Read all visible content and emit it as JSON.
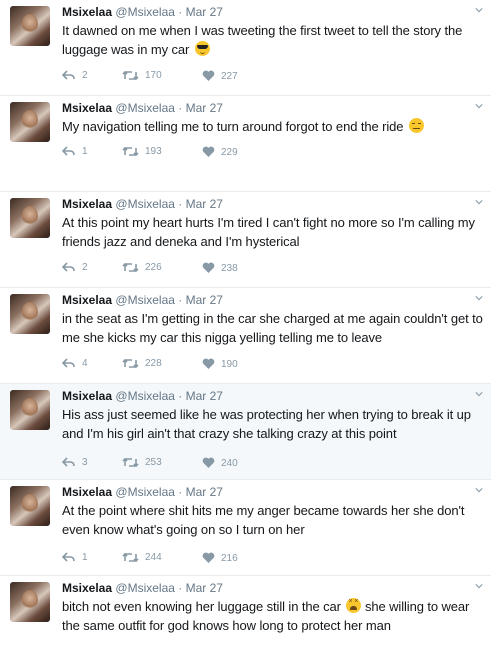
{
  "colors": {
    "name": "#14171a",
    "meta": "#657786",
    "icon": "#8899a6",
    "border": "#e6ecf0",
    "highlight_bg": "#f5f8fa"
  },
  "icons": {
    "reply": "reply-icon",
    "retweet": "retweet-icon",
    "like": "heart-icon",
    "menu": "chevron-down-icon"
  },
  "tweets": [
    {
      "name": "Msixelaa",
      "handle": "@Msixelaa",
      "separator": "·",
      "date": "Mar 27",
      "text": "It dawned on me when I was tweeting the first tweet to tell the story the luggage was in my car",
      "emoji": "sunglasses",
      "replies": "2",
      "retweets": "170",
      "likes": "227"
    },
    {
      "name": "Msixelaa",
      "handle": "@Msixelaa",
      "separator": "·",
      "date": "Mar 27",
      "text": "My navigation telling me to turn around forgot to end the ride",
      "emoji": "expressionless",
      "replies": "1",
      "retweets": "193",
      "likes": "229"
    },
    {
      "name": "Msixelaa",
      "handle": "@Msixelaa",
      "separator": "·",
      "date": "Mar 27",
      "text": "At this point my heart hurts I'm tired I can't fight no more so I'm calling my friends jazz and deneka and I'm hysterical",
      "replies": "2",
      "retweets": "226",
      "likes": "238"
    },
    {
      "name": "Msixelaa",
      "handle": "@Msixelaa",
      "separator": "·",
      "date": "Mar 27",
      "text": "in the seat as I'm getting in the car she charged at me again couldn't get to me she kicks my car this nigga yelling telling me to leave",
      "replies": "4",
      "retweets": "228",
      "likes": "190"
    },
    {
      "name": "Msixelaa",
      "handle": "@Msixelaa",
      "separator": "·",
      "date": "Mar 27",
      "text": "His ass just seemed like he was protecting her when trying to break it up and I'm his girl ain't that crazy she talking crazy at this point",
      "replies": "3",
      "retweets": "253",
      "likes": "240"
    },
    {
      "name": "Msixelaa",
      "handle": "@Msixelaa",
      "separator": "·",
      "date": "Mar 27",
      "text": "At the point where shit hits me my anger became towards her she don't even know what's going on so I turn on her",
      "replies": "1",
      "retweets": "244",
      "likes": "216"
    },
    {
      "name": "Msixelaa",
      "handle": "@Msixelaa",
      "separator": "·",
      "date": "Mar 27",
      "text_before": "bitch not even knowing her luggage still in the car",
      "emoji": "tired",
      "text_after": "she willing to wear the same outfit for god knows how long to protect her man"
    }
  ]
}
